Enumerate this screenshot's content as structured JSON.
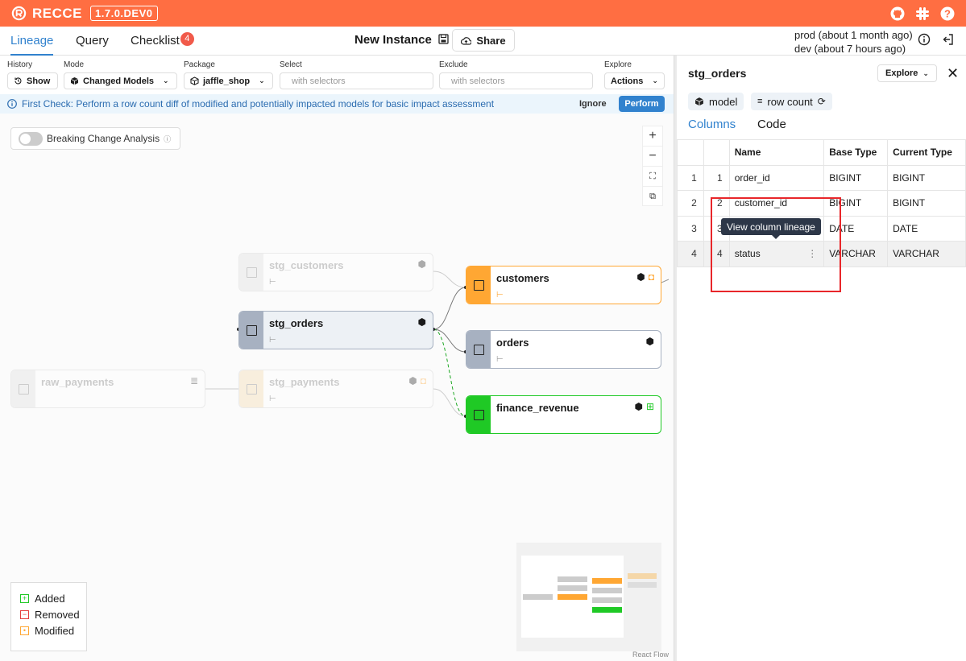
{
  "app": {
    "name": "RECCE",
    "version": "1.7.0.DEV0"
  },
  "nav": {
    "tabs": [
      {
        "label": "Lineage"
      },
      {
        "label": "Query"
      },
      {
        "label": "Checklist",
        "badge": "4"
      }
    ],
    "instance_name": "New Instance",
    "share_label": "Share",
    "env_prod": "prod (about 1 month ago)",
    "env_dev": "dev (about 7 hours ago)"
  },
  "toolbar": {
    "history_label": "History",
    "history_value": "Show",
    "mode_label": "Mode",
    "mode_value": "Changed Models",
    "package_label": "Package",
    "package_value": "jaffle_shop",
    "select_label": "Select",
    "select_placeholder": "with selectors",
    "exclude_label": "Exclude",
    "exclude_placeholder": "with selectors",
    "explore_label": "Explore",
    "actions_label": "Actions"
  },
  "banner": {
    "text": "First Check: Perform a row count diff of modified and potentially impacted models for basic impact assessment",
    "ignore_label": "Ignore",
    "perform_label": "Perform"
  },
  "canvas": {
    "breaking_change_label": "Breaking Change Analysis",
    "nodes": {
      "stg_customers": "stg_customers",
      "stg_orders": "stg_orders",
      "raw_payments": "raw_payments",
      "stg_payments": "stg_payments",
      "customers": "customers",
      "orders": "orders",
      "finance_revenue": "finance_revenue"
    },
    "legend": {
      "added": "Added",
      "removed": "Removed",
      "modified": "Modified"
    },
    "react_flow_label": "React Flow",
    "colors": {
      "modified": "#ffa733",
      "added": "#1fc925",
      "selected": "#a7b1c1",
      "unchanged": "#a7b1c1"
    }
  },
  "panel": {
    "title": "stg_orders",
    "explore_label": "Explore",
    "chip_type": "model",
    "chip_rowcount": "row count",
    "tabs": {
      "columns": "Columns",
      "code": "Code"
    },
    "headers": {
      "name": "Name",
      "base_type": "Base Type",
      "current_type": "Current Type"
    },
    "rows": [
      {
        "idx": "1",
        "pos": "1",
        "name": "order_id",
        "base": "BIGINT",
        "current": "BIGINT"
      },
      {
        "idx": "2",
        "pos": "2",
        "name": "customer_id",
        "base": "BIGINT",
        "current": "BIGINT"
      },
      {
        "idx": "3",
        "pos": "3",
        "name": "",
        "base": "DATE",
        "current": "DATE"
      },
      {
        "idx": "4",
        "pos": "4",
        "name": "status",
        "base": "VARCHAR",
        "current": "VARCHAR"
      }
    ],
    "tooltip": "View column lineage"
  }
}
